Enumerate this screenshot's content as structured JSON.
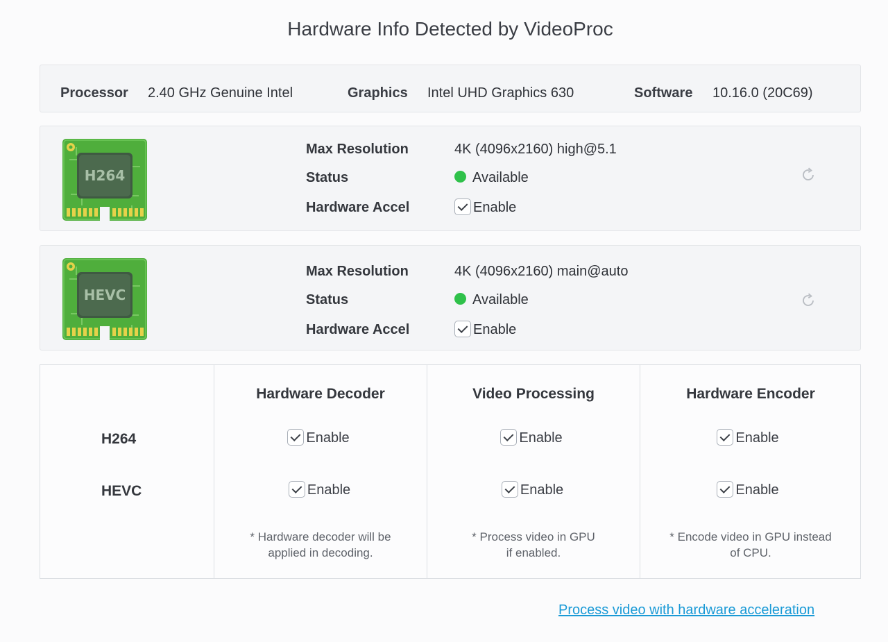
{
  "title": "Hardware Info Detected by VideoProc",
  "system": {
    "processor_label": "Processor",
    "processor_value": "2.40 GHz Genuine Intel",
    "graphics_label": "Graphics",
    "graphics_value": "Intel UHD Graphics 630",
    "software_label": "Software",
    "software_value": "10.16.0 (20C69)"
  },
  "codecs": [
    {
      "chip_label": "H264",
      "max_res_label": "Max Resolution",
      "max_res_value": "4K (4096x2160) high@5.1",
      "status_label": "Status",
      "status_value": "Available",
      "accel_label": "Hardware Accel",
      "accel_value": "Enable",
      "icon": "refresh-icon"
    },
    {
      "chip_label": "HEVC",
      "max_res_label": "Max Resolution",
      "max_res_value": "4K (4096x2160) main@auto",
      "status_label": "Status",
      "status_value": "Available",
      "accel_label": "Hardware Accel",
      "accel_value": "Enable",
      "icon": "refresh-icon"
    }
  ],
  "matrix": {
    "columns": [
      "Hardware Decoder",
      "Video Processing",
      "Hardware Encoder"
    ],
    "rows": [
      {
        "name": "H264",
        "cells": [
          "Enable",
          "Enable",
          "Enable"
        ]
      },
      {
        "name": "HEVC",
        "cells": [
          "Enable",
          "Enable",
          "Enable"
        ]
      }
    ],
    "notes": [
      [
        "* Hardware decoder will be",
        "applied in decoding."
      ],
      [
        "* Process video in GPU",
        "if enabled."
      ],
      [
        "* Encode video in GPU instead",
        "of CPU."
      ]
    ]
  },
  "link_text": "Process video with hardware acceleration",
  "colors": {
    "chip_green": "#4fae3c",
    "status_green": "#2fc14a",
    "link_blue": "#1a9ad6"
  }
}
